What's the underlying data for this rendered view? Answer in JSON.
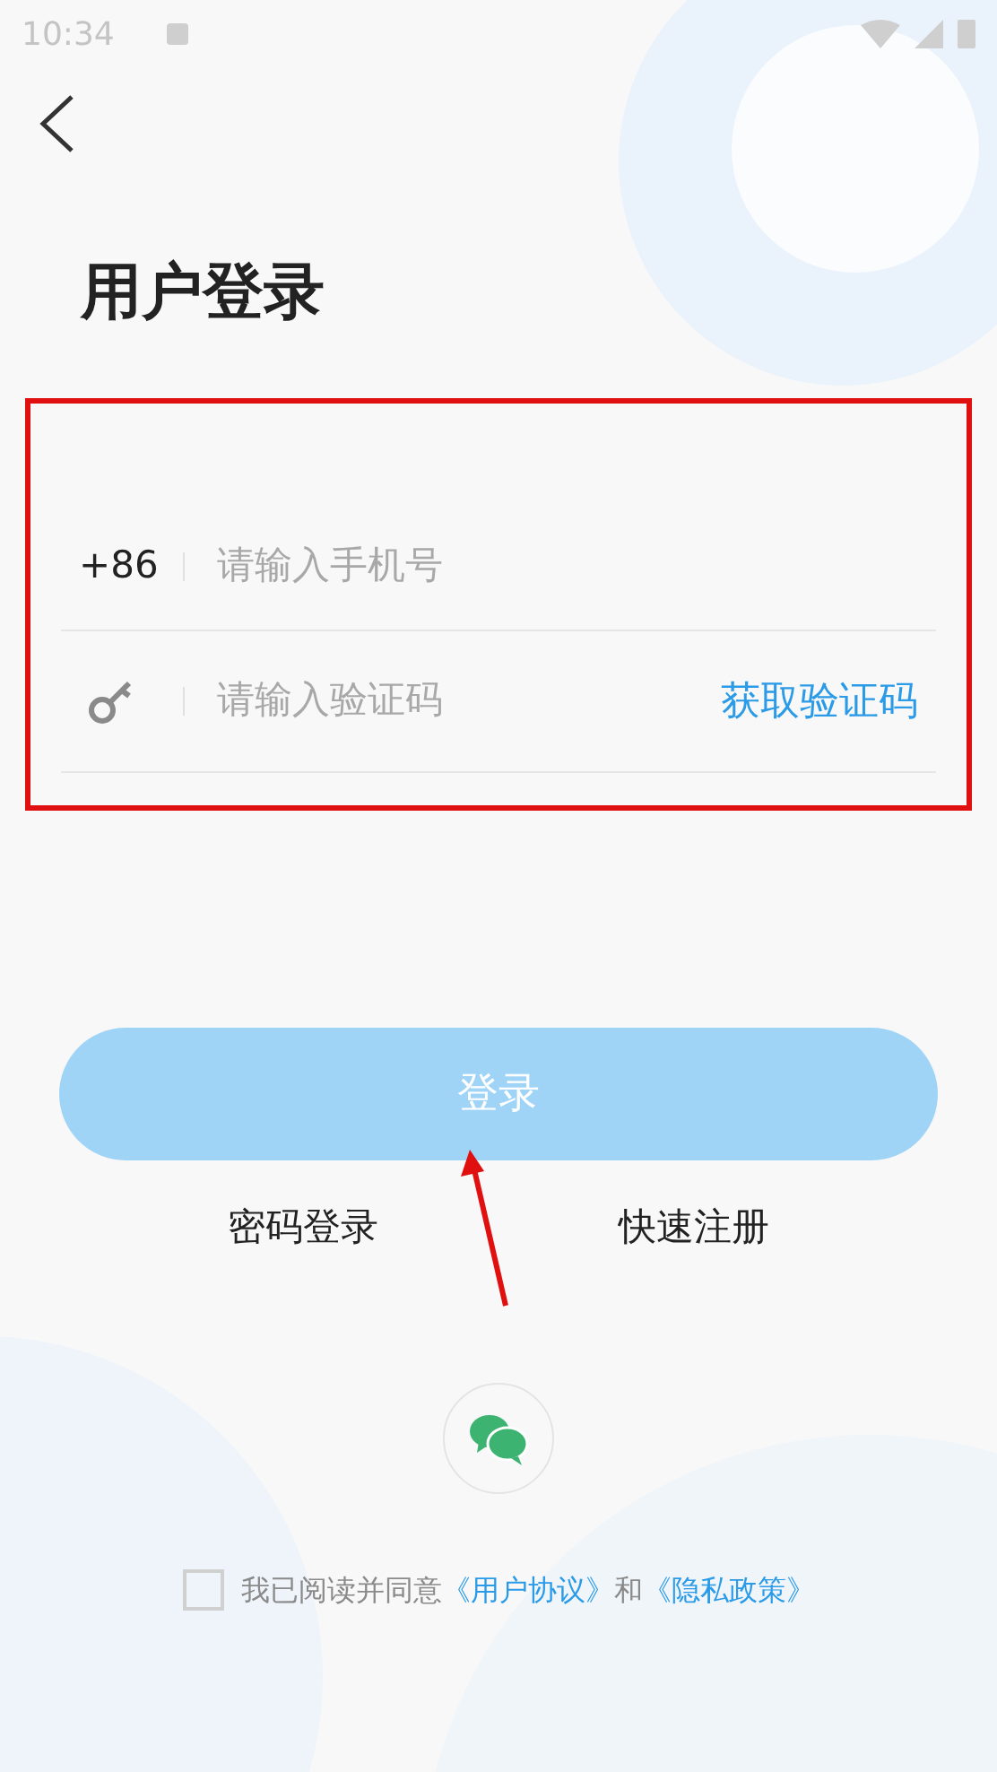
{
  "status_bar": {
    "time": "10:34"
  },
  "title": "用户登录",
  "phone_field": {
    "prefix": "+86",
    "placeholder": "请输入手机号"
  },
  "code_field": {
    "placeholder": "请输入验证码",
    "action": "获取验证码"
  },
  "login_button": {
    "label": "登录",
    "disabled": true
  },
  "links": [
    "密码登录",
    "快速注册"
  ],
  "agreement": {
    "checked": false,
    "text": "我已阅读并同意",
    "link_1": "《用户协议》",
    "joiner": "和",
    "link_2": "《隐私政策》"
  }
}
